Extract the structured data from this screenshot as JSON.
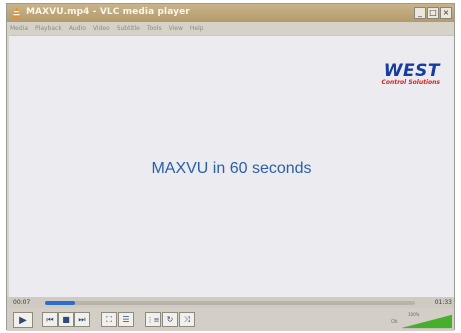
{
  "window": {
    "title": "MAXVU.mp4 - VLC media player",
    "buttons": [
      "_",
      "□",
      "×"
    ]
  },
  "menu": [
    "Media",
    "Playback",
    "Audio",
    "Video",
    "Subtitle",
    "Tools",
    "View",
    "Help"
  ],
  "video": {
    "logo_main": "WEST",
    "logo_sub": "Control Solutions",
    "caption": "MAXVU in 60 seconds"
  },
  "playback": {
    "elapsed": "00:07",
    "total": "01:33",
    "progress_fraction": 0.08
  },
  "controls": {
    "play": "▶",
    "prev": "⏮",
    "stop": "■",
    "next": "⏭",
    "fullscreen": "⛶",
    "extended": "☰",
    "playlist": "⋮≡",
    "loop": "↻",
    "shuffle": "⤨"
  },
  "volume": {
    "label": "Ok",
    "percent_text": "100%",
    "level": 1.0
  },
  "colors": {
    "accent": "#2a6dd0",
    "caption": "#2a5fa8",
    "logo": "#173c9e",
    "logo_sub": "#d12323"
  },
  "icons": {
    "app": "vlc-cone-icon"
  }
}
